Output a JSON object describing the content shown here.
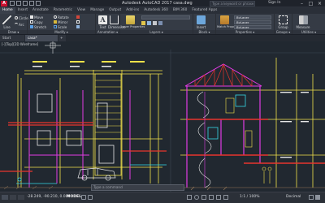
{
  "titlebar": {
    "logo": "A",
    "title": "Autodesk AutoCAD 2017  casa.dwg",
    "search_placeholder": "Type a keyword or phrase",
    "signin": "Sign In"
  },
  "menu_tabs": [
    "Home",
    "Insert",
    "Annotate",
    "Parametric",
    "View",
    "Manage",
    "Output",
    "Add-ins",
    "Autodesk 360",
    "BIM 360",
    "Featured Apps"
  ],
  "ribbon": {
    "draw": {
      "line": "Line",
      "circle": "Circle",
      "arc": "Arc",
      "title": "Draw ▾"
    },
    "modify": {
      "move": "Move",
      "rotate": "Rotate",
      "copy": "Copy",
      "mirror": "Mirror",
      "stretch": "Stretch",
      "scale": "Scale",
      "title": "Modify ▾"
    },
    "annotation": {
      "text": "Text",
      "dimension": "Dimension",
      "title": "Annotation ▾"
    },
    "layers": {
      "properties": "Layer Properties",
      "title": "Layers ▾"
    },
    "block": {
      "insert": "Insert",
      "title": "Block ▾"
    },
    "properties": {
      "match": "Match Properties",
      "bylayer1": "ByLayer",
      "bylayer2": "ByLayer",
      "bylayer3": "ByLayer",
      "title": "Properties ▾"
    },
    "groups": {
      "group": "Group",
      "title": "Groups ▾"
    },
    "utilities": {
      "measure": "Measure",
      "title": "Utilities ▾"
    }
  },
  "file_tabs": {
    "start": "Start",
    "drawing": "casa*"
  },
  "canvas": {
    "view_label": "[-][Top][2D Wireframe]"
  },
  "command_placeholder": "Type a command",
  "status": {
    "coords": "-28.249, -90.210, 0.000",
    "model": "MODEL",
    "scale": "1:1 / 100%",
    "decimal": "Decimal"
  },
  "colors": {
    "background": "#212830",
    "ribbon": "#353b45",
    "accent_red": "#c8102e",
    "yellow_lines": "#f3e24a",
    "magenta_lines": "#e23be4",
    "red_lines": "#e8342d",
    "cyan_lines": "#36d7e4",
    "white_lines": "#e8e8e8"
  }
}
